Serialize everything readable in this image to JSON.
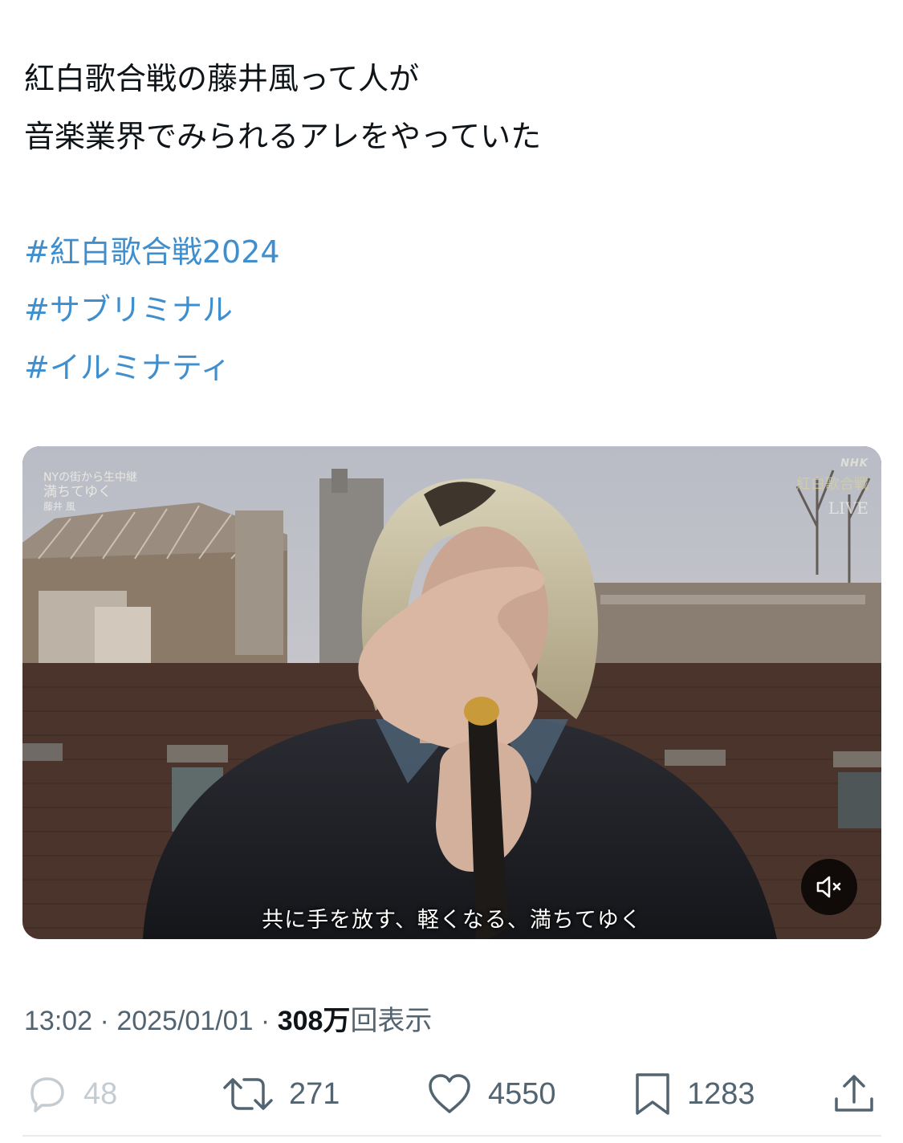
{
  "tweet": {
    "lines": [
      "紅白歌合戦の藤井風って人が",
      "音楽業界でみられるアレをやっていた"
    ],
    "hashtags": [
      "#紅白歌合戦2024",
      "#サブリミナル",
      "#イルミナティ"
    ]
  },
  "media": {
    "overlay": {
      "program": "NYの街から生中継",
      "song": "満ちてゆく",
      "artist": "藤井 風",
      "network": "NHK",
      "badge": "紅白歌合戦",
      "live": "LIVE"
    },
    "subtitle": "共に手を放す、軽くなる、満ちてゆく",
    "mute_icon": "speaker-muted-icon"
  },
  "meta": {
    "time": "13:02",
    "separator": " · ",
    "date": "2025/01/01",
    "views_number": "308万",
    "views_label": "回表示"
  },
  "actions": {
    "replies": "48",
    "reposts": "271",
    "likes": "4550",
    "bookmarks": "1283"
  },
  "colors": {
    "hashtag": "#3f8fcf",
    "secondary_text": "#536471",
    "primary_text": "#0f1419"
  }
}
